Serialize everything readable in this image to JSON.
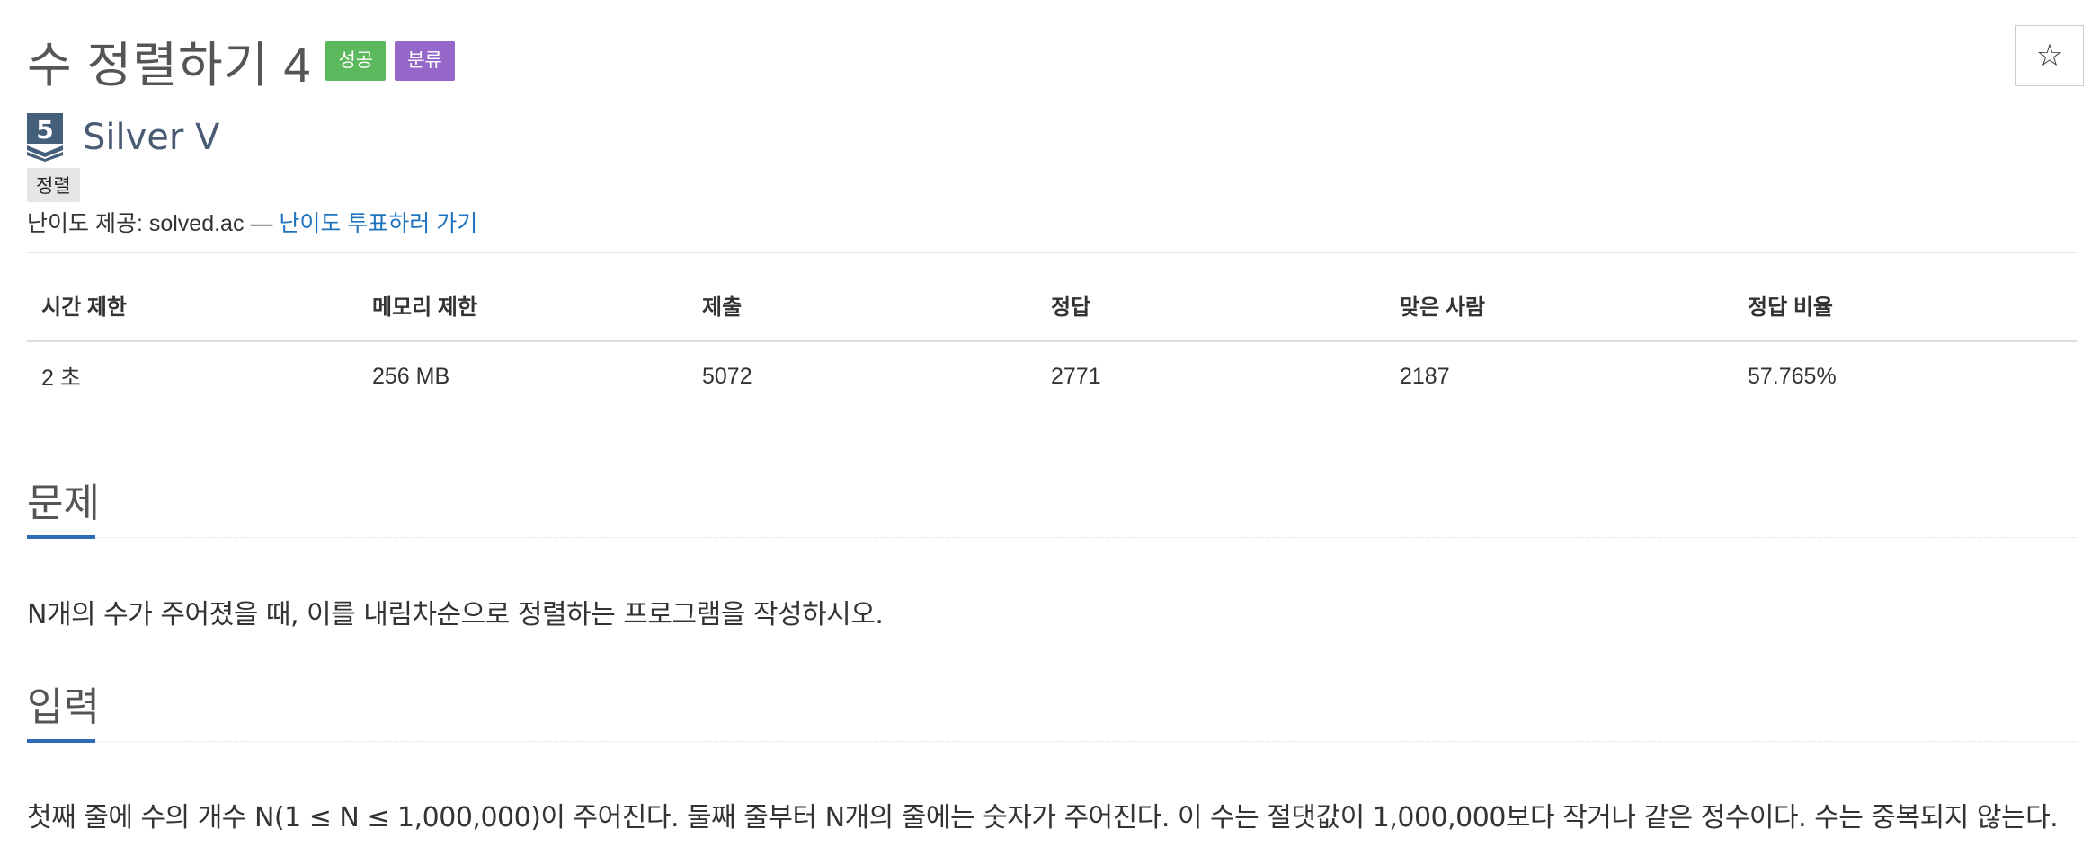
{
  "problem": {
    "title": "수 정렬하기 4",
    "badges": {
      "success": "성공",
      "category": "분류"
    },
    "star": "☆"
  },
  "tier": {
    "name": "Silver V",
    "level": "5",
    "color": "#435f7a"
  },
  "tags": [
    "정렬"
  ],
  "difficulty": {
    "prefix": "난이도 제공: solved.ac — ",
    "vote_link": "난이도 투표하러 가기"
  },
  "info_table": {
    "headers": [
      "시간 제한",
      "메모리 제한",
      "제출",
      "정답",
      "맞은 사람",
      "정답 비율"
    ],
    "values": [
      "2 초",
      "256 MB",
      "5072",
      "2771",
      "2187",
      "57.765%"
    ]
  },
  "sections": {
    "problem": {
      "title": "문제",
      "text": "N개의 수가 주어졌을 때, 이를 내림차순으로 정렬하는 프로그램을 작성하시오."
    },
    "input": {
      "title": "입력",
      "text": "첫째 줄에 수의 개수 N(1 ≤ N ≤ 1,000,000)이 주어진다. 둘째 줄부터 N개의 줄에는 숫자가 주어진다. 이 수는 절댓값이 1,000,000보다 작거나 같은 정수이다. 수는 중복되지 않는다."
    }
  },
  "colors": {
    "success_badge": "#5cb85c",
    "category_badge": "#9467c9",
    "link": "#1e73be",
    "section_underline": "#2e6bb5"
  }
}
